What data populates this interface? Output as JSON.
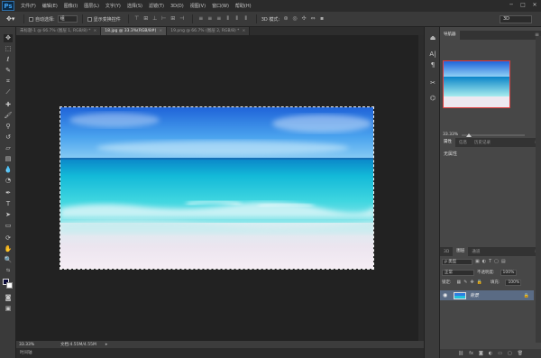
{
  "app": {
    "logo": "Ps",
    "menu": [
      "文件(F)",
      "编辑(E)",
      "图像(I)",
      "图层(L)",
      "文字(Y)",
      "选择(S)",
      "滤镜(T)",
      "3D(D)",
      "视图(V)",
      "窗口(W)",
      "帮助(H)"
    ],
    "window_controls": [
      "─",
      "□",
      "✕"
    ]
  },
  "options_bar": {
    "auto_select_label": "自动选择:",
    "auto_select_value": "组",
    "show_transform_label": "显示变换控件",
    "mode_3d_label": "3D 模式:",
    "workspace_value": "3D"
  },
  "tabs": [
    {
      "label": "未标题-1 @ 66.7% (图层 1, RGB/8) *",
      "active": false
    },
    {
      "label": "18.jpg @ 33.3%(RGB/8#)",
      "active": true
    },
    {
      "label": "19.png @ 66.7% (图层 2, RGB/8) *",
      "active": false
    }
  ],
  "status": {
    "zoom": "33.33%",
    "doc_info": "文档:4.55M/4.55M",
    "timeline_label": "时间轴"
  },
  "panels": {
    "navigator_tab": "导航器",
    "navigator_zoom": "33.33%",
    "properties_tabs": [
      "属性",
      "信息",
      "历史记录"
    ],
    "properties_text": "无属性",
    "layers_tabs": [
      "3D",
      "图层",
      "通道"
    ],
    "layer_filter": "ρ 类型",
    "blend_mode": "正常",
    "opacity_label": "不透明度:",
    "opacity_value": "100%",
    "lock_label": "锁定:",
    "fill_label": "填充:",
    "fill_value": "100%",
    "layer_name": "背景"
  },
  "colors": {
    "foreground": "#0b0b3a",
    "background": "#ffffff",
    "selected_layer": "#5a6b84",
    "navigator_box": "#e23d3d"
  }
}
